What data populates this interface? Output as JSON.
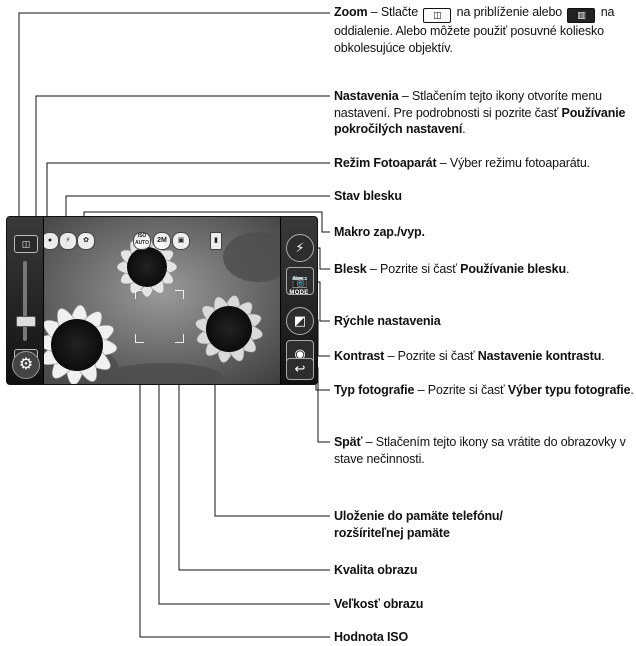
{
  "camera": {
    "zoom_in_icon": "zoom-in-icon",
    "zoom_out_icon": "zoom-out-icon",
    "zoom_level": 0.25,
    "mode_button_label": "MODE",
    "status_icons": {
      "iso": "ISO\nAUTO",
      "size": "2M",
      "quality": "",
      "storage": ""
    }
  },
  "annotations": {
    "zoom": {
      "title": "Zoom",
      "text_a": " – Stlačte ",
      "text_b": " na priblíženie alebo ",
      "text_c": " na oddialenie. Alebo môžete použiť posuvné koliesko obkolesujúce objektív."
    },
    "settings": {
      "title": "Nastavenia",
      "text": " – Stlačením tejto ikony otvoríte menu nastavení. Pre podrobnosti si pozrite časť ",
      "ref": "Používanie pokročilých nastavení",
      "end": "."
    },
    "camera_mode": {
      "title": "Režim Fotoaparát",
      "text": " – Výber režimu fotoaparátu."
    },
    "flash_status": {
      "title": "Stav blesku"
    },
    "macro": {
      "title": "Makro zap./vyp."
    },
    "flash": {
      "title": "Blesk",
      "text": " – Pozrite si časť ",
      "ref": "Používanie blesku",
      "end": "."
    },
    "quick_settings": {
      "title": "Rýchle nastavenia"
    },
    "contrast": {
      "title": "Kontrast",
      "text": " – Pozrite si časť ",
      "ref": "Nastavenie kontrastu",
      "end": "."
    },
    "photo_type": {
      "title": "Typ fotografie",
      "text": " – Pozrite si časť ",
      "ref": "Výber typu fotografie",
      "end": "."
    },
    "back": {
      "title": "Späť",
      "text": " – Stlačením tejto ikony sa vrátite do obrazovky v stave nečinnosti."
    },
    "storage": {
      "title_line1": "Uloženie do pamäte telefónu/",
      "title_line2": "rozšíriteľnej pamäte"
    },
    "quality": {
      "title": "Kvalita obrazu"
    },
    "size": {
      "title": "Veľkosť obrazu"
    },
    "iso": {
      "title": "Hodnota ISO"
    }
  }
}
